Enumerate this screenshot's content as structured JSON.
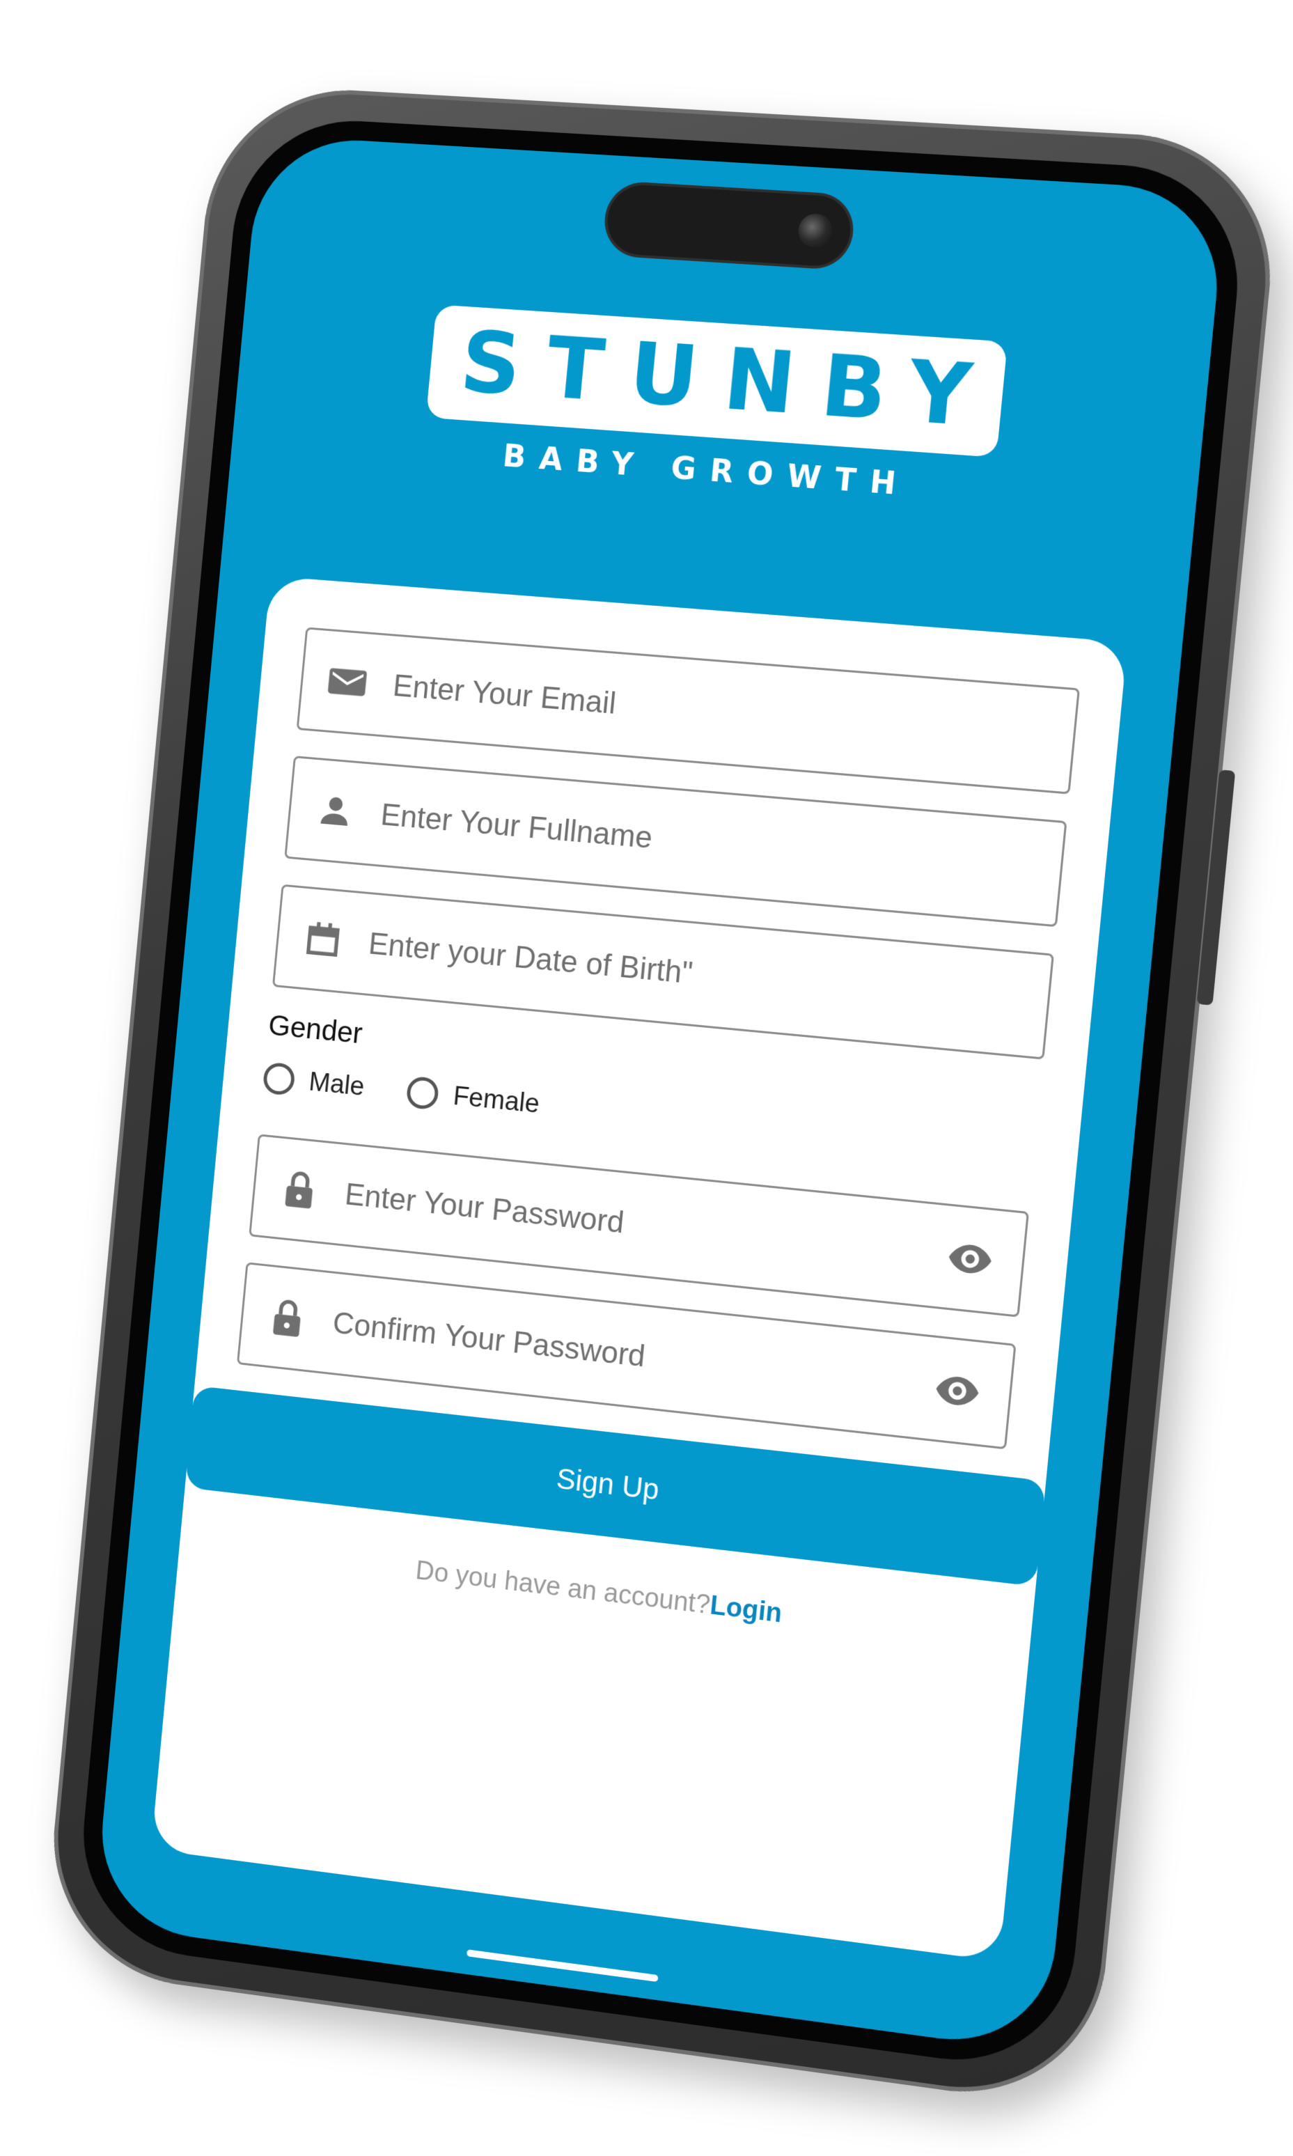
{
  "app": {
    "logo_title": "STUNBY",
    "logo_subtitle": "BABY GROWTH"
  },
  "form": {
    "email": {
      "placeholder": "Enter Your Email",
      "value": "",
      "icon": "email-icon"
    },
    "fullname": {
      "placeholder": "Enter Your Fullname",
      "value": "",
      "icon": "person-icon"
    },
    "dob": {
      "placeholder": "Enter your Date of Birth\"",
      "value": "",
      "icon": "calendar-icon"
    },
    "gender": {
      "label": "Gender",
      "options": [
        "Male",
        "Female"
      ],
      "selected": null
    },
    "password": {
      "placeholder": "Enter Your Password",
      "value": "",
      "icon": "lock-icon",
      "toggle_icon": "eye-icon"
    },
    "confirm_password": {
      "placeholder": "Confirm Your Password",
      "value": "",
      "icon": "lock-icon",
      "toggle_icon": "eye-icon"
    },
    "submit_label": "Sign Up"
  },
  "footer": {
    "question": "Do you have an account?",
    "login_label": "Login"
  },
  "colors": {
    "brand": "#0399cc",
    "card": "#ffffff",
    "icon": "#6f6f6f",
    "link": "#0a86be"
  }
}
